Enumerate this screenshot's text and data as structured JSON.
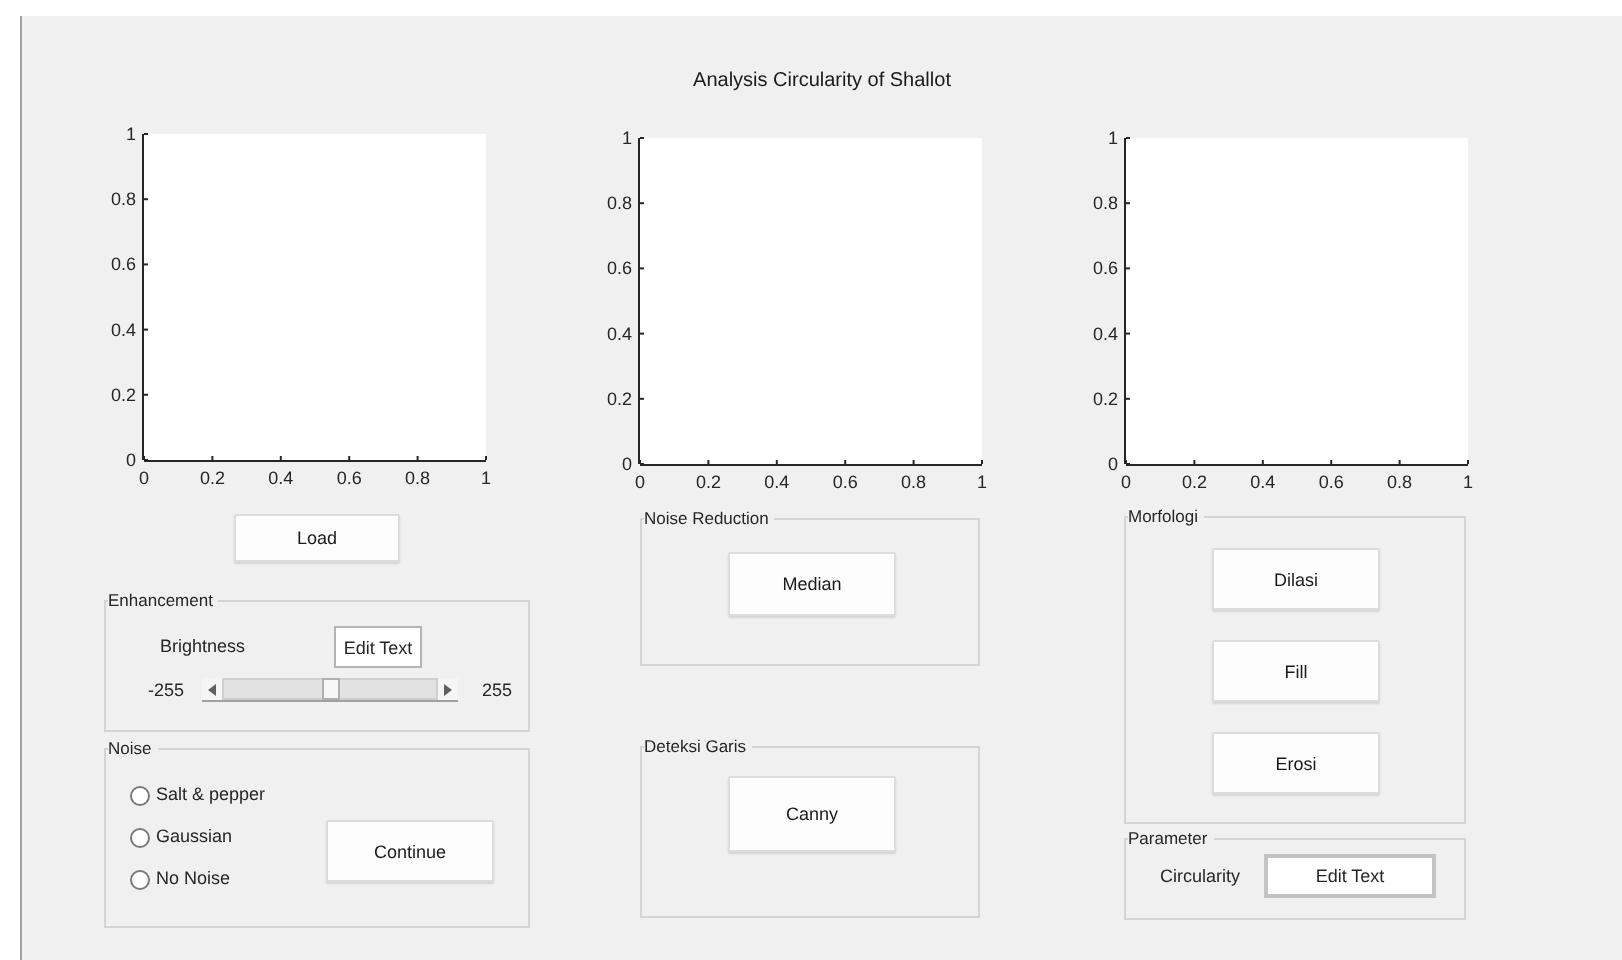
{
  "window": {
    "title": "Analysis Circularity of Shallot"
  },
  "columns": [
    {
      "axes": {
        "chart_data": {
          "type": "line",
          "xlim": [
            0,
            1
          ],
          "ylim": [
            0,
            1
          ],
          "xticks": [
            0,
            0.2,
            0.4,
            0.6,
            0.8,
            1
          ],
          "yticks": [
            0,
            0.2,
            0.4,
            0.6,
            0.8,
            1
          ]
        }
      },
      "items": [
        {
          "kind": "button",
          "label": "Load"
        },
        {
          "kind": "slider_panel",
          "title": "Enhancement",
          "label": "Brightness",
          "field": {
            "value": "Edit Text"
          },
          "slider": {
            "min_label": "-255",
            "max_label": "255",
            "level": 0.5
          }
        },
        {
          "kind": "radio_panel",
          "title": "Noise",
          "options": [
            {
              "label": "Salt & pepper",
              "selected": false
            },
            {
              "label": "Gaussian",
              "selected": false
            },
            {
              "label": "No Noise",
              "selected": false
            }
          ],
          "button": "Continue"
        }
      ]
    },
    {
      "axes": {
        "chart_data": {
          "type": "line",
          "xlim": [
            0,
            1
          ],
          "ylim": [
            0,
            1
          ],
          "xticks": [
            0,
            0.2,
            0.4,
            0.6,
            0.8,
            1
          ],
          "yticks": [
            0,
            0.2,
            0.4,
            0.6,
            0.8,
            1
          ]
        }
      },
      "items": [
        {
          "kind": "button_panel",
          "title": "Noise Reduction",
          "buttons": [
            "Median"
          ]
        },
        {
          "kind": "button_panel",
          "title": "Deteksi Garis",
          "buttons": [
            "Canny"
          ]
        }
      ]
    },
    {
      "axes": {
        "chart_data": {
          "type": "line",
          "xlim": [
            0,
            1
          ],
          "ylim": [
            0,
            1
          ],
          "xticks": [
            0,
            0.2,
            0.4,
            0.6,
            0.8,
            1
          ],
          "yticks": [
            0,
            0.2,
            0.4,
            0.6,
            0.8,
            1
          ]
        }
      },
      "items": [
        {
          "kind": "button_panel",
          "title": "Morfologi",
          "buttons": [
            "Dilasi",
            "Fill",
            "Erosi"
          ]
        },
        {
          "kind": "field_panel",
          "title": "Parameter",
          "label": "Circularity",
          "field": {
            "value": "Edit Text"
          }
        }
      ]
    }
  ]
}
